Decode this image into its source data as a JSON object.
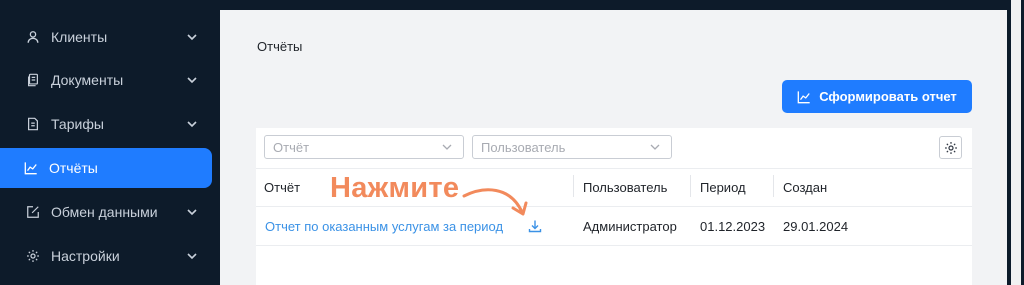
{
  "sidebar": {
    "items": [
      {
        "label": "Клиенты",
        "icon": "user-icon"
      },
      {
        "label": "Документы",
        "icon": "documents-icon"
      },
      {
        "label": "Тарифы",
        "icon": "tariff-icon"
      },
      {
        "label": "Отчёты",
        "icon": "chart-icon",
        "active": true
      },
      {
        "label": "Обмен данными",
        "icon": "edit-box-icon"
      },
      {
        "label": "Настройки",
        "icon": "gear-icon"
      }
    ]
  },
  "page": {
    "title": "Отчёты"
  },
  "toolbar": {
    "generate_label": "Сформировать отчет"
  },
  "filters": {
    "report_placeholder": "Отчёт",
    "user_placeholder": "Пользователь"
  },
  "table": {
    "headers": [
      "Отчёт",
      "Пользователь",
      "Период",
      "Создан"
    ],
    "rows": [
      {
        "report": "Отчет по оказанным услугам за период",
        "user": "Администратор",
        "period": "01.12.2023",
        "created": "29.01.2024"
      }
    ]
  },
  "annotation": {
    "text": "Нажмите"
  },
  "colors": {
    "accent": "#1f7cff",
    "sidebar": "#0d1b2a",
    "link": "#3b92e6",
    "annotation": "#f28a5c"
  }
}
